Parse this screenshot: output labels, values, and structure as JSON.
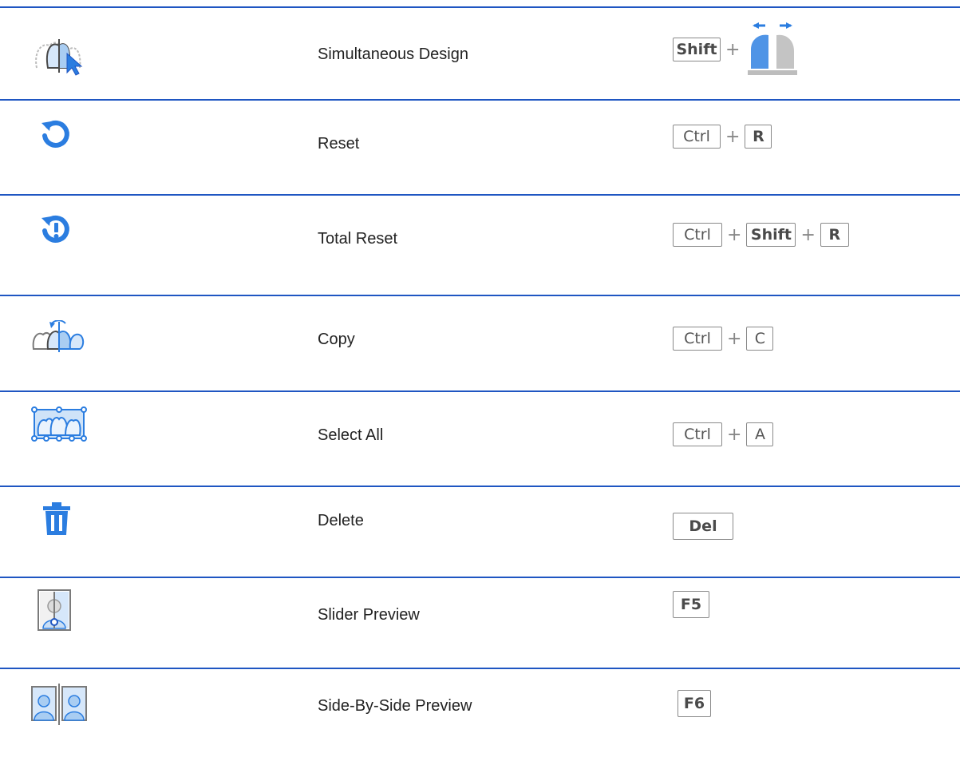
{
  "shortcuts": [
    {
      "icon": "simultaneous-design-icon",
      "label": "Simultaneous Design",
      "keys": [
        "Shift"
      ],
      "extra": "split-arrows-graphic"
    },
    {
      "icon": "reset-icon",
      "label": "Reset",
      "keys": [
        "Ctrl",
        "R"
      ]
    },
    {
      "icon": "total-reset-icon",
      "label": "Total Reset",
      "keys": [
        "Ctrl",
        "Shift",
        "R"
      ]
    },
    {
      "icon": "copy-teeth-icon",
      "label": "Copy",
      "keys": [
        "Ctrl",
        "C"
      ]
    },
    {
      "icon": "select-all-teeth-icon",
      "label": "Select All",
      "keys": [
        "Ctrl",
        "A"
      ]
    },
    {
      "icon": "trash-icon",
      "label": "Delete",
      "keys": [
        "Del"
      ]
    },
    {
      "icon": "slider-preview-icon",
      "label": "Slider Preview",
      "keys": [
        "F5"
      ]
    },
    {
      "icon": "side-by-side-preview-icon",
      "label": "Side-By-Side Preview",
      "keys": [
        "F6"
      ]
    }
  ],
  "plus_sign": "+",
  "colors": {
    "accent": "#1f56c2",
    "icon_blue": "#2b7de0",
    "icon_light": "#a9cdf2",
    "key_border": "#8a8a8a"
  }
}
